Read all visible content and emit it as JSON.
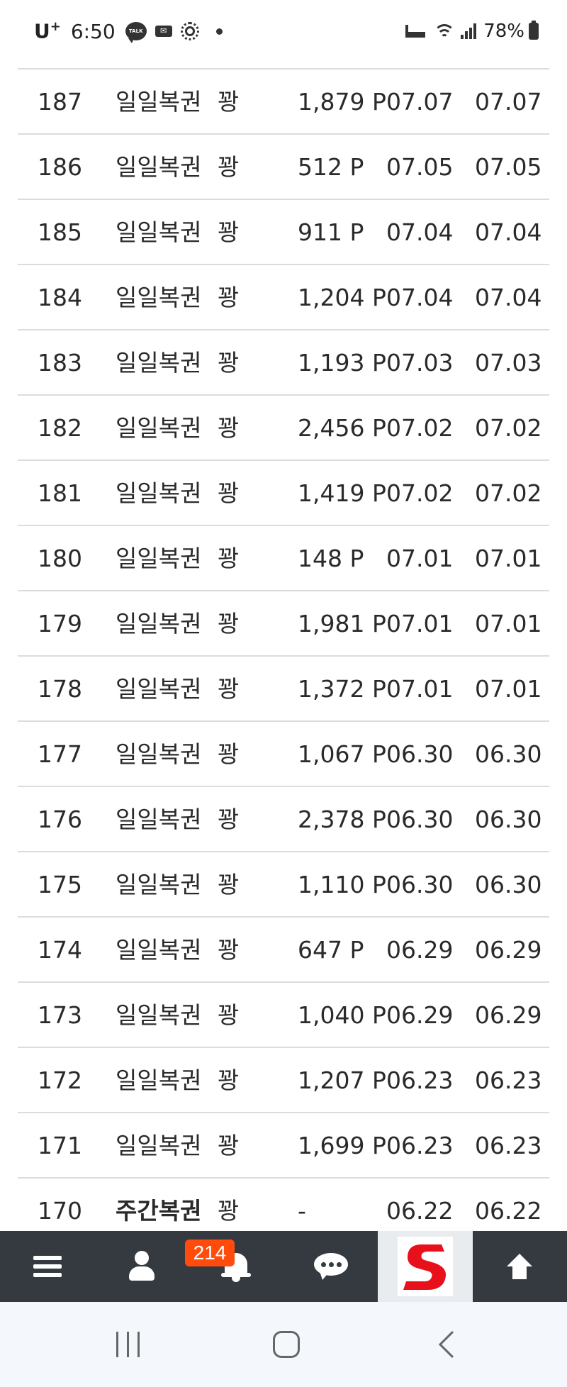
{
  "status_bar": {
    "carrier": "U",
    "carrier_sup": "+",
    "time": "6:50",
    "talk_label": "TALK",
    "battery": "78%"
  },
  "rows": [
    {
      "no": "187",
      "type": "일일복권",
      "result": "꽝",
      "points": "1,879 P",
      "date1": "07.07",
      "date2": "07.07",
      "bold": false
    },
    {
      "no": "186",
      "type": "일일복권",
      "result": "꽝",
      "points": "512 P",
      "date1": "07.05",
      "date2": "07.05",
      "bold": false
    },
    {
      "no": "185",
      "type": "일일복권",
      "result": "꽝",
      "points": "911 P",
      "date1": "07.04",
      "date2": "07.04",
      "bold": false
    },
    {
      "no": "184",
      "type": "일일복권",
      "result": "꽝",
      "points": "1,204 P",
      "date1": "07.04",
      "date2": "07.04",
      "bold": false
    },
    {
      "no": "183",
      "type": "일일복권",
      "result": "꽝",
      "points": "1,193 P",
      "date1": "07.03",
      "date2": "07.03",
      "bold": false
    },
    {
      "no": "182",
      "type": "일일복권",
      "result": "꽝",
      "points": "2,456 P",
      "date1": "07.02",
      "date2": "07.02",
      "bold": false
    },
    {
      "no": "181",
      "type": "일일복권",
      "result": "꽝",
      "points": "1,419 P",
      "date1": "07.02",
      "date2": "07.02",
      "bold": false
    },
    {
      "no": "180",
      "type": "일일복권",
      "result": "꽝",
      "points": "148 P",
      "date1": "07.01",
      "date2": "07.01",
      "bold": false
    },
    {
      "no": "179",
      "type": "일일복권",
      "result": "꽝",
      "points": "1,981 P",
      "date1": "07.01",
      "date2": "07.01",
      "bold": false
    },
    {
      "no": "178",
      "type": "일일복권",
      "result": "꽝",
      "points": "1,372 P",
      "date1": "07.01",
      "date2": "07.01",
      "bold": false
    },
    {
      "no": "177",
      "type": "일일복권",
      "result": "꽝",
      "points": "1,067 P",
      "date1": "06.30",
      "date2": "06.30",
      "bold": false
    },
    {
      "no": "176",
      "type": "일일복권",
      "result": "꽝",
      "points": "2,378 P",
      "date1": "06.30",
      "date2": "06.30",
      "bold": false
    },
    {
      "no": "175",
      "type": "일일복권",
      "result": "꽝",
      "points": "1,110 P",
      "date1": "06.30",
      "date2": "06.30",
      "bold": false
    },
    {
      "no": "174",
      "type": "일일복권",
      "result": "꽝",
      "points": "647 P",
      "date1": "06.29",
      "date2": "06.29",
      "bold": false
    },
    {
      "no": "173",
      "type": "일일복권",
      "result": "꽝",
      "points": "1,040 P",
      "date1": "06.29",
      "date2": "06.29",
      "bold": false
    },
    {
      "no": "172",
      "type": "일일복권",
      "result": "꽝",
      "points": "1,207 P",
      "date1": "06.23",
      "date2": "06.23",
      "bold": false
    },
    {
      "no": "171",
      "type": "일일복권",
      "result": "꽝",
      "points": "1,699 P",
      "date1": "06.23",
      "date2": "06.23",
      "bold": false
    },
    {
      "no": "170",
      "type": "주간복권",
      "result": "꽝",
      "points": "-",
      "date1": "06.22",
      "date2": "06.22",
      "bold": true
    }
  ],
  "bottom_nav": {
    "notification_count": "214",
    "items": [
      "menu-icon",
      "user-icon",
      "bell-icon",
      "chat-icon",
      "site-logo",
      "arrow-up-icon"
    ]
  },
  "colors": {
    "nav_bg": "#343a40",
    "badge_bg": "#ff4c0d",
    "logo_red": "#e8101a",
    "divider": "#dcdcdc"
  }
}
